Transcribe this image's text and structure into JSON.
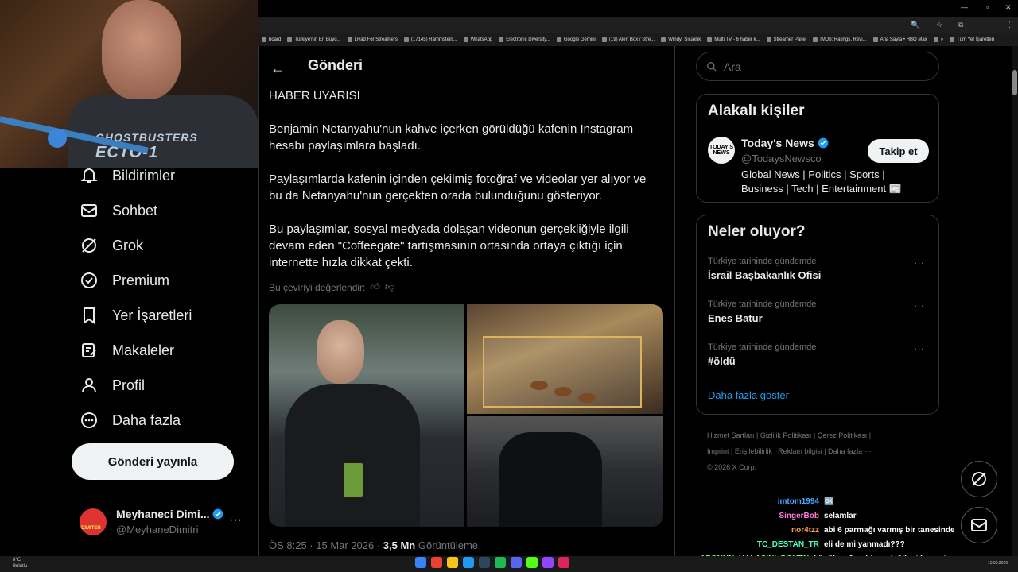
{
  "browser": {
    "bookmarks": [
      "board",
      "Türkiye'nin En Büyü...",
      "Livad For Streamers",
      "(17145) Rammstein...",
      "WhatsApp",
      "Electronic Diversity...",
      "Google Gemini",
      "(19) Alert Box / Stre...",
      "Windy: Sıcaklık",
      "Multi TV - 6 haber k...",
      "Streamer Panel",
      "IMDb: Ratings, Revi...",
      "Ana Sayfa • HBO Max",
      "»",
      "Tüm Yer İşaretleri"
    ]
  },
  "webcam": {
    "shirt_text_1": "GHOSTBUSTERS",
    "shirt_text_2": "ECTO-1"
  },
  "nav": {
    "items": [
      {
        "label": "Bildirimler",
        "icon": "bell-icon"
      },
      {
        "label": "Sohbet",
        "icon": "mail-icon"
      },
      {
        "label": "Grok",
        "icon": "grok-icon"
      },
      {
        "label": "Premium",
        "icon": "verified-badge-icon"
      },
      {
        "label": "Yer İşaretleri",
        "icon": "bookmark-icon"
      },
      {
        "label": "Makaleler",
        "icon": "article-icon"
      },
      {
        "label": "Profil",
        "icon": "person-icon"
      },
      {
        "label": "Daha fazla",
        "icon": "more-circle-icon"
      }
    ],
    "post_button": "Gönderi yayınla",
    "profile": {
      "name": "Meyhaneci Dimi...",
      "handle": "@MeyhaneDimitri",
      "avatar_text": "DIMITER"
    }
  },
  "main": {
    "title": "Gönderi",
    "tweet": {
      "heading": "HABER UYARISI",
      "p1": "Benjamin Netanyahu'nun kahve içerken görüldüğü kafenin Instagram hesabı paylaşımlara başladı.",
      "p2": "Paylaşımlarda kafenin içinden çekilmiş fotoğraf ve videolar yer alıyor ve bu da Netanyahu'nun gerçekten orada bulunduğunu gösteriyor.",
      "p3": "Bu paylaşımlar, sosyal medyada dolaşan videonun gerçekliğiyle ilgili devam eden \"Coffeegate\" tartışmasının ortasında ortaya çıktığı için internette hızla dikkat çekti.",
      "rate_label": "Bu çeviriyi değerlendir:"
    },
    "meta": {
      "time": "ÖS 8:25 · 15 Mar 2026 · ",
      "views": "3,5 Mn",
      "views_label": " Görüntüleme"
    }
  },
  "sidebar": {
    "search_placeholder": "Ara",
    "related": {
      "title": "Alakalı kişiler",
      "logo_text": "TODAY'S NEWS",
      "name": "Today's News",
      "handle": "@TodaysNewsco",
      "bio": "Global News | Politics | Sports | Business | Tech | Entertainment 📰",
      "follow": "Takip et"
    },
    "trends": {
      "title": "Neler oluyor?",
      "items": [
        {
          "context": "Türkiye tarihinde gündemde",
          "name": "İsrail Başbakanlık Ofisi"
        },
        {
          "context": "Türkiye tarihinde gündemde",
          "name": "Enes Batur"
        },
        {
          "context": "Türkiye tarihinde gündemde",
          "name": "#öldü"
        }
      ],
      "show_more": "Daha fazla göster"
    },
    "footer": {
      "line1": "Hizmet Şartları  |  Gizlilik Politikası  |  Çerez Politikası  |",
      "line2": "Imprint  |  Erişilebilirlik  |  Reklam bilgisi  |  Daha fazla ···",
      "line3": "© 2026 X Corp."
    }
  },
  "chat": [
    {
      "user": "imtom1994",
      "msg": "🆗",
      "color": "#4aa8ff"
    },
    {
      "user": "SingerBob",
      "msg": "selamlar",
      "color": "#ff7ad9"
    },
    {
      "user": "nor4tzz",
      "msg": "abi 6 parmağı varmış bir tanesinde",
      "color": "#ff9a4a"
    },
    {
      "user": "TC_DESTAN_TR",
      "msg": "eli de mi yanmadı???",
      "color": "#4affc8"
    },
    {
      "user": "APONUN_HALASINI_DOVEN",
      "msg": "köpük yoğun bişey değil mi ben mi malım amk",
      "color": "#8aff6a"
    }
  ],
  "taskbar": {
    "weather_temp": "8°C",
    "weather_desc": "Bulutlu",
    "date": "15.03.2026"
  }
}
